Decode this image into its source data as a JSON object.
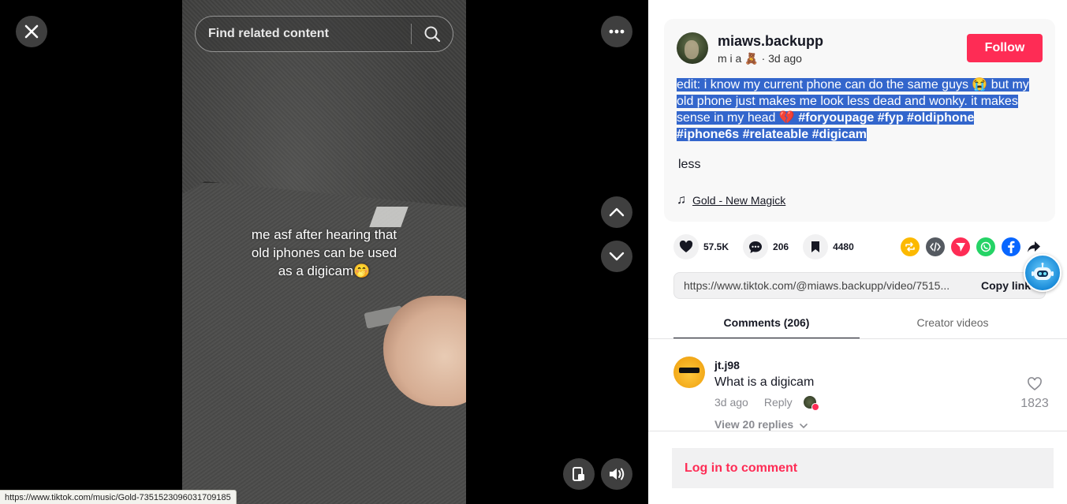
{
  "video": {
    "search_placeholder": "Find related content",
    "caption_lines": [
      "me asf after hearing that",
      "old iphones can be used",
      "as a digicam🤭"
    ]
  },
  "status_bar": {
    "url": "https://www.tiktok.com/music/Gold-7351523096031709185"
  },
  "post": {
    "username": "miaws.backupp",
    "nickname": "m i a 🧸",
    "time_ago": "· 3d ago",
    "follow_label": "Follow",
    "description_text_1": "edit: i know my current phone can do the same guys 😭 but my old phone just makes me look less dead and wonky. it makes sense in my head 💔 ",
    "hashtags": [
      "#foryoupage",
      "#fyp",
      "#oldiphone",
      "#iphone6s",
      "#relateable",
      "#digicam"
    ],
    "less_label": "less",
    "music_title": "Gold - New Magick"
  },
  "actions": {
    "likes": "57.5K",
    "comments": "206",
    "saves": "4480"
  },
  "share": {
    "link_url": "https://www.tiktok.com/@miaws.backupp/video/7515...",
    "copy_label": "Copy link",
    "icons": [
      "repost-icon",
      "embed-icon",
      "send-icon",
      "whatsapp-icon",
      "facebook-icon",
      "share-arrow-icon"
    ],
    "colors": {
      "repost": "#fcb900",
      "embed": "#555a61",
      "send": "#fe2c55",
      "whatsapp": "#25d366",
      "facebook": "#0866ff"
    }
  },
  "tabs": [
    {
      "label": "Comments (206)",
      "active": true
    },
    {
      "label": "Creator videos",
      "active": false
    }
  ],
  "comment": {
    "user": "jt.j98",
    "text": "What is a digicam",
    "time": "3d ago",
    "reply_label": "Reply",
    "view_replies": "View 20 replies",
    "likes": "1823"
  },
  "login_label": "Log in to comment",
  "theme": {
    "accent": "#fe2c55",
    "selection": "#3366cc"
  }
}
